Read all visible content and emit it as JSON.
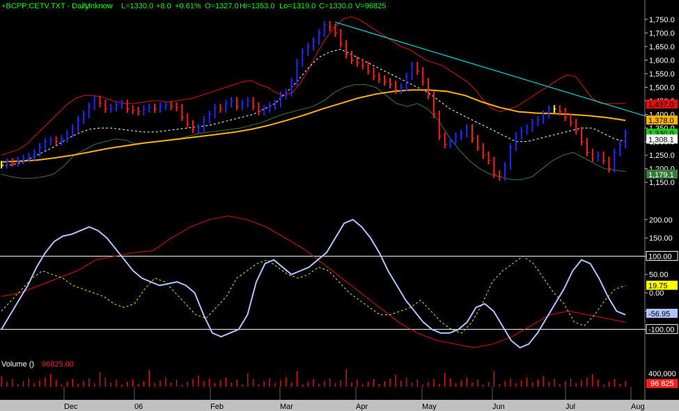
{
  "header": {
    "symbol": "+BCPP:CETV.TXT - Daily",
    "sector": "Unknow",
    "last": "L=1330.0",
    "change": "+8.0",
    "change_pct": "+0.61%",
    "open": "O=1327.0",
    "high": "Hi=1353.0",
    "low": "Lo=1319.0",
    "close": "C=1330.0",
    "volume": "V=96825"
  },
  "colors": {
    "background": "#000000",
    "bar_up": "#1e28ff",
    "bar_down": "#ff1e1e",
    "bar_neutral": "#ffff00",
    "upper_band": "#e01010",
    "lower_band": "#3a7a3a",
    "mid_band": "#ffffff",
    "ma": "#ffb300",
    "trendline": "#00ffff",
    "cci": "#b0c4ff",
    "cci_signal": "#e6e600",
    "cci_slow": "#e01010",
    "volume": "#e01010"
  },
  "chart_data": [
    {
      "type": "line",
      "title": "Price (OHLC bars with Bollinger Bands and moving average)",
      "y_ticks": [
        "1,750.0",
        "1,700.0",
        "1,650.0",
        "1,600.0",
        "1,550.0",
        "1,500.0",
        "1,450.0",
        "1,400.0",
        "1,350.0",
        "1,300.0",
        "1,250.0",
        "1,200.0",
        "1,150.0"
      ],
      "ylim": [
        1130,
        1765
      ],
      "x_ticks": [
        "Dec",
        "06",
        "Feb",
        "Mar",
        "Apr",
        "May",
        "Jun",
        "Jul",
        "Aug"
      ],
      "price_close": [
        1215,
        1225,
        1222,
        1230,
        1238,
        1245,
        1258,
        1280,
        1300,
        1305,
        1300,
        1310,
        1330,
        1350,
        1380,
        1400,
        1430,
        1455,
        1440,
        1420,
        1425,
        1435,
        1440,
        1420,
        1415,
        1410,
        1420,
        1425,
        1420,
        1430,
        1435,
        1430,
        1425,
        1390,
        1365,
        1345,
        1350,
        1380,
        1400,
        1425,
        1420,
        1440,
        1450,
        1430,
        1440,
        1450,
        1430,
        1410,
        1420,
        1430,
        1440,
        1470,
        1480,
        1520,
        1590,
        1630,
        1650,
        1670,
        1700,
        1730,
        1720,
        1700,
        1660,
        1620,
        1600,
        1590,
        1580,
        1560,
        1540,
        1530,
        1520,
        1510,
        1490,
        1500,
        1540,
        1580,
        1560,
        1520,
        1470,
        1400,
        1320,
        1290,
        1300,
        1320,
        1330,
        1350,
        1310,
        1280,
        1250,
        1230,
        1180,
        1170,
        1210,
        1280,
        1320,
        1340,
        1350,
        1370,
        1380,
        1400,
        1420,
        1420,
        1410,
        1390,
        1370,
        1340,
        1300,
        1260,
        1240,
        1250,
        1230,
        1200,
        1260,
        1290,
        1330
      ],
      "upper_band": [
        1250,
        1260,
        1270,
        1290,
        1320,
        1350,
        1380,
        1410,
        1440,
        1460,
        1470,
        1470,
        1465,
        1455,
        1445,
        1440,
        1440,
        1445,
        1450,
        1450,
        1445,
        1450,
        1455,
        1460,
        1470,
        1480,
        1490,
        1500,
        1510,
        1520,
        1525,
        1510,
        1500,
        1480,
        1470,
        1480,
        1520,
        1570,
        1630,
        1680,
        1720,
        1750,
        1760,
        1750,
        1730,
        1710,
        1690,
        1670,
        1650,
        1640,
        1620,
        1600,
        1590,
        1580,
        1560,
        1540,
        1520,
        1490,
        1450,
        1420,
        1410,
        1420,
        1430,
        1450,
        1470,
        1490,
        1510,
        1530,
        1545,
        1540,
        1500,
        1460,
        1440,
        1440,
        1440,
        1440
      ],
      "lower_band": [
        1180,
        1170,
        1165,
        1165,
        1170,
        1180,
        1210,
        1250,
        1270,
        1290,
        1300,
        1310,
        1305,
        1290,
        1295,
        1300,
        1305,
        1310,
        1320,
        1330,
        1335,
        1340,
        1345,
        1350,
        1360,
        1370,
        1385,
        1400,
        1410,
        1420,
        1430,
        1450,
        1480,
        1500,
        1510,
        1510,
        1500,
        1470,
        1440,
        1430,
        1440,
        1420,
        1380,
        1320,
        1270,
        1230,
        1200,
        1180,
        1170,
        1160,
        1160,
        1170,
        1200,
        1230,
        1250,
        1260,
        1240,
        1220,
        1200,
        1195,
        1190
      ],
      "mid_band": [
        1210,
        1215,
        1225,
        1245,
        1265,
        1285,
        1310,
        1330,
        1345,
        1350,
        1350,
        1345,
        1340,
        1335,
        1335,
        1340,
        1345,
        1350,
        1355,
        1360,
        1370,
        1380,
        1390,
        1400,
        1420,
        1440,
        1480,
        1520,
        1570,
        1610,
        1630,
        1640,
        1620,
        1600,
        1580,
        1560,
        1540,
        1520,
        1500,
        1480,
        1450,
        1420,
        1400,
        1380,
        1360,
        1340,
        1320,
        1300,
        1300,
        1310,
        1320,
        1330,
        1340,
        1350,
        1350,
        1330,
        1310,
        1300
      ],
      "moving_average": [
        1225,
        1228,
        1232,
        1240,
        1250,
        1262,
        1275,
        1285,
        1295,
        1302,
        1310,
        1318,
        1326,
        1334,
        1345,
        1360,
        1378,
        1398,
        1420,
        1440,
        1460,
        1475,
        1485,
        1490,
        1490,
        1485,
        1470,
        1445,
        1425,
        1410,
        1405,
        1403,
        1400,
        1395,
        1388,
        1378
      ],
      "trendline": [
        [
          1,
          1740
        ],
        [
          1,
          1372
        ]
      ],
      "last_labels": [
        "1,437.0",
        "1,378.0",
        "1,330.0",
        "1,308.1",
        "1,179.1"
      ]
    },
    {
      "type": "line",
      "title": "CCI oscillator",
      "y_ticks": [
        "200.00",
        "150.00",
        "100.00",
        "50.00",
        "0.00",
        "-50.00",
        "-100.00"
      ],
      "ylim": [
        -150,
        230
      ],
      "levels": [
        100,
        -100
      ],
      "cci": [
        -100,
        -60,
        -20,
        20,
        70,
        110,
        140,
        155,
        160,
        170,
        180,
        170,
        150,
        120,
        90,
        60,
        40,
        30,
        20,
        25,
        30,
        20,
        0,
        -60,
        -110,
        -120,
        -110,
        -100,
        -60,
        30,
        80,
        90,
        70,
        50,
        60,
        70,
        90,
        110,
        150,
        190,
        200,
        180,
        150,
        110,
        60,
        20,
        -20,
        -50,
        -80,
        -100,
        -110,
        -110,
        -100,
        -80,
        -40,
        -30,
        -50,
        -90,
        -130,
        -150,
        -140,
        -110,
        -70,
        -30,
        10,
        60,
        90,
        80,
        40,
        -10,
        -50,
        -60
      ],
      "cci_signal": [
        -50,
        -20,
        10,
        40,
        60,
        50,
        40,
        20,
        10,
        0,
        -10,
        -30,
        -40,
        -30,
        10,
        40,
        30,
        0,
        -30,
        -60,
        -70,
        -40,
        -10,
        40,
        60,
        80,
        90,
        70,
        50,
        40,
        50,
        70,
        60,
        30,
        0,
        -20,
        -40,
        -60,
        -60,
        -50,
        -40,
        -20,
        -50,
        -80,
        -100,
        -110,
        -80,
        -30,
        30,
        60,
        80,
        100,
        80,
        40,
        0,
        -30,
        -80,
        -90,
        -60,
        -20,
        10,
        20
      ],
      "cci_slow": [
        -10,
        0,
        20,
        40,
        60,
        90,
        100,
        110,
        115,
        150,
        180,
        200,
        210,
        200,
        180,
        150,
        120,
        80,
        40,
        0,
        -40,
        -80,
        -110,
        -130,
        -140,
        -150,
        -140,
        -120,
        -90,
        -60,
        -50,
        -60,
        -70,
        -80
      ],
      "last_labels": [
        "100.00",
        "19.75",
        "-56.95",
        "-100.00"
      ]
    },
    {
      "type": "bar",
      "title": "Volume ()",
      "value_label": "96825.00",
      "y_ticks": [
        "400,000"
      ],
      "last_label": "96 825"
    }
  ],
  "labels": {
    "volume_title": "Volume ()",
    "volume_value": "96825.00"
  }
}
